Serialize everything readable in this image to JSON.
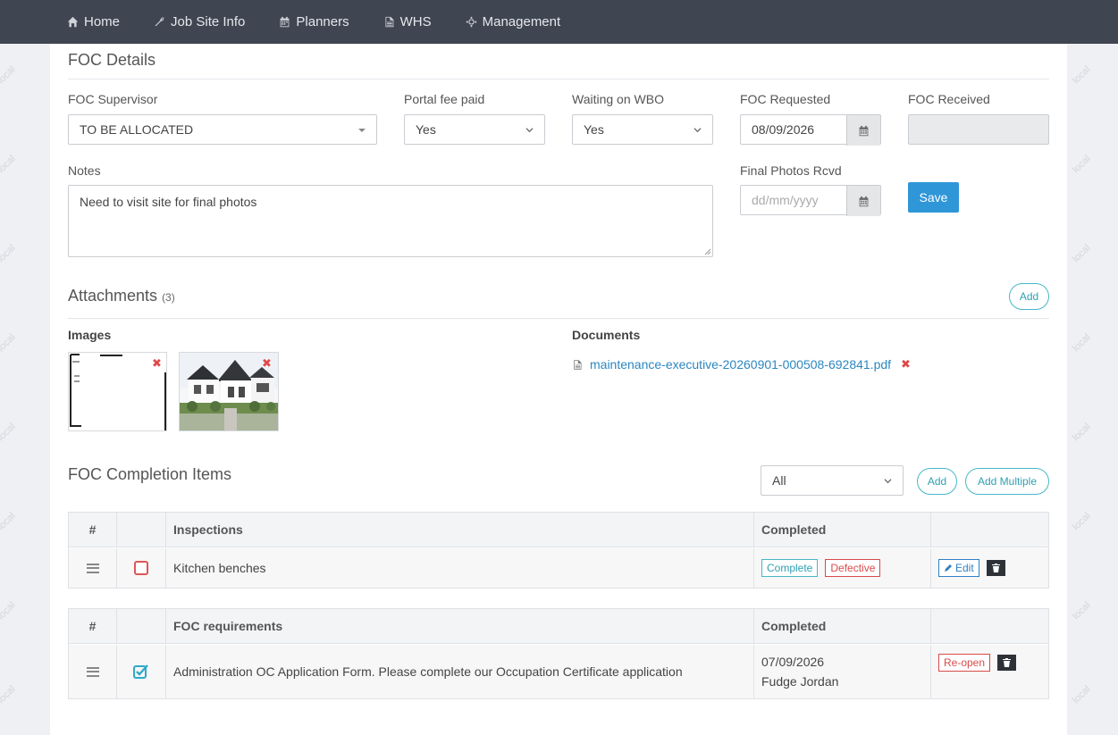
{
  "nav": {
    "items": [
      {
        "label": "Home",
        "icon": "home-icon"
      },
      {
        "label": "Job Site Info",
        "icon": "wrench-icon"
      },
      {
        "label": "Planners",
        "icon": "calendar-icon"
      },
      {
        "label": "WHS",
        "icon": "file-icon"
      },
      {
        "label": "Management",
        "icon": "crosshair-icon"
      }
    ]
  },
  "watermark": "local",
  "foc": {
    "title": "FOC Details",
    "supervisor": {
      "label": "FOC Supervisor",
      "value": "TO BE ALLOCATED"
    },
    "portal_fee": {
      "label": "Portal fee paid",
      "value": "Yes"
    },
    "waiting_wbo": {
      "label": "Waiting on WBO",
      "value": "Yes"
    },
    "requested": {
      "label": "FOC Requested",
      "value": "08/09/2026"
    },
    "received": {
      "label": "FOC Received",
      "value": ""
    },
    "notes": {
      "label": "Notes",
      "value": "Need to visit site for final photos"
    },
    "final_photos": {
      "label": "Final Photos Rcvd",
      "placeholder": "dd/mm/yyyy"
    },
    "save_label": "Save"
  },
  "attachments": {
    "title": "Attachments",
    "count": "(3)",
    "add_label": "Add",
    "images_label": "Images",
    "documents_label": "Documents",
    "documents": [
      {
        "name": "maintenance-executive-20260901-000508-692841.pdf"
      }
    ]
  },
  "completion": {
    "title": "FOC Completion Items",
    "filter_value": "All",
    "add_label": "Add",
    "add_multiple_label": "Add Multiple",
    "tables": [
      {
        "headers": {
          "num": "#",
          "name": "Inspections",
          "completed": "Completed"
        },
        "rows": [
          {
            "name": "Kitchen benches",
            "checked": false,
            "tags": [
              "Complete",
              "Defective"
            ],
            "action": "Edit"
          }
        ]
      },
      {
        "headers": {
          "num": "#",
          "name": "FOC requirements",
          "completed": "Completed"
        },
        "rows": [
          {
            "name": "Administration OC Application Form. Please complete our Occupation Certificate application",
            "checked": true,
            "date": "07/09/2026",
            "by": "Fudge Jordan",
            "action": "Re-open"
          }
        ]
      }
    ]
  },
  "colors": {
    "navbar": "#3f4551",
    "accent": "#2f96d8",
    "teal": "#47b7c7",
    "danger": "#d94a4a"
  }
}
